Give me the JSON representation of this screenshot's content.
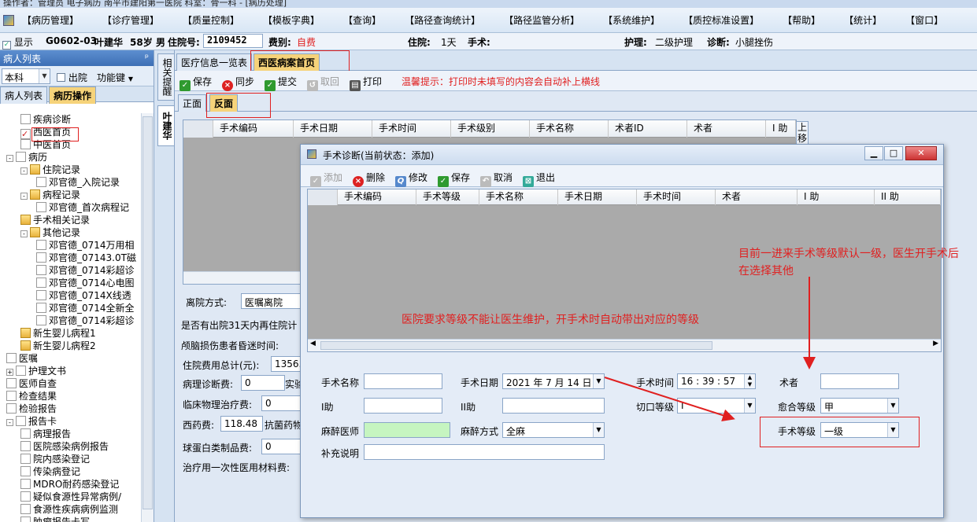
{
  "window_title": "操作者：管理员 电子病历 南平市建阳第一医院 科室：骨一科 - [病历处理]",
  "menu": [
    "【病历管理】",
    "【诊疗管理】",
    "【质量控制】",
    "【模板字典】",
    "【查询】",
    "【路径查询统计】",
    "【路径监管分析】",
    "【系统维护】",
    "【质控标准设置】",
    "【帮助】",
    "【统计】",
    "【窗口】"
  ],
  "patient": {
    "show_label": "显示",
    "bed_no": "G0602-03",
    "name": "叶建华",
    "age": "58岁",
    "sex": "男",
    "admission_no_label": "住院号:",
    "admission_no": "2109452",
    "fee_type_label": "费别:",
    "fee_type": "自费",
    "stay_label": "住院:",
    "stay": "1天",
    "surgery_label": "手术:",
    "nursing_label": "护理:",
    "nursing": "二级护理",
    "diagnosis_label": "诊断:",
    "diagnosis": "小腿挫伤"
  },
  "left_panel": {
    "title": "病人列表",
    "pin": "ᵖ",
    "dept": "本科",
    "discharged_label": "出院",
    "function_key_label": "功能键",
    "tabs": [
      "病人列表",
      "病历操作"
    ],
    "tree": [
      {
        "label": "疾病诊断",
        "level": 1,
        "icon": "doc"
      },
      {
        "label": "西医首页",
        "level": 1,
        "icon": "check"
      },
      {
        "label": "中医首页",
        "level": 1,
        "icon": "doc"
      },
      {
        "label": "病历",
        "level": 0,
        "icon": "doc",
        "expand": "-"
      },
      {
        "label": "住院记录",
        "level": 1,
        "icon": "folder",
        "expand": "-"
      },
      {
        "label": "邓官德_入院记录",
        "level": 2,
        "icon": "doc"
      },
      {
        "label": "病程记录",
        "level": 1,
        "icon": "folder",
        "expand": "-"
      },
      {
        "label": "邓官德_首次病程记",
        "level": 2,
        "icon": "doc"
      },
      {
        "label": "手术相关记录",
        "level": 1,
        "icon": "folder"
      },
      {
        "label": "其他记录",
        "level": 1,
        "icon": "folder",
        "expand": "-"
      },
      {
        "label": "邓官德_0714万用相",
        "level": 2,
        "icon": "doc"
      },
      {
        "label": "邓官德_07143.0T磁",
        "level": 2,
        "icon": "doc"
      },
      {
        "label": "邓官德_0714彩超诊",
        "level": 2,
        "icon": "doc"
      },
      {
        "label": "邓官德_0714心电图",
        "level": 2,
        "icon": "doc"
      },
      {
        "label": "邓官德_0714X线透",
        "level": 2,
        "icon": "doc"
      },
      {
        "label": "邓官德_0714全新全",
        "level": 2,
        "icon": "doc"
      },
      {
        "label": "邓官德_0714彩超诊",
        "level": 2,
        "icon": "doc"
      },
      {
        "label": "新生婴儿病程1",
        "level": 1,
        "icon": "folder"
      },
      {
        "label": "新生婴儿病程2",
        "level": 1,
        "icon": "folder"
      },
      {
        "label": "医嘱",
        "level": 0,
        "icon": "doc"
      },
      {
        "label": "护理文书",
        "level": 0,
        "icon": "doc",
        "expand": "+"
      },
      {
        "label": "医师自查",
        "level": 0,
        "icon": "doc"
      },
      {
        "label": "检查结果",
        "level": 0,
        "icon": "doc"
      },
      {
        "label": "检验报告",
        "level": 0,
        "icon": "doc"
      },
      {
        "label": "报告卡",
        "level": 0,
        "icon": "doc",
        "expand": "-"
      },
      {
        "label": "病理报告",
        "level": 1,
        "icon": "doc"
      },
      {
        "label": "医院感染病例报告",
        "level": 1,
        "icon": "doc"
      },
      {
        "label": "院内感染登记",
        "level": 1,
        "icon": "doc"
      },
      {
        "label": "传染病登记",
        "level": 1,
        "icon": "doc"
      },
      {
        "label": "MDRO耐药感染登记",
        "level": 1,
        "icon": "doc"
      },
      {
        "label": "疑似食源性异常病例/",
        "level": 1,
        "icon": "doc"
      },
      {
        "label": "食源性疾病病例监测",
        "level": 1,
        "icon": "doc"
      },
      {
        "label": "肿瘤报告卡写",
        "level": 1,
        "icon": "doc"
      }
    ]
  },
  "side_tabs": [
    "相关提醒",
    "叶建华"
  ],
  "main": {
    "top_tabs": [
      "医疗信息一览表",
      "西医病案首页"
    ],
    "toolbar": [
      "保存",
      "同步",
      "提交",
      "取回",
      "打印"
    ],
    "hint": "温馨提示：打印时未填写的内容会自动补上横线",
    "sub_tabs": [
      "正面",
      "反面"
    ],
    "grid_columns": [
      "手术编码",
      "手术日期",
      "手术时间",
      "手术级别",
      "手术名称",
      "术者ID",
      "术者",
      "I 助"
    ],
    "side_button": "上移",
    "form": {
      "discharge_mode_label": "离院方式:",
      "discharge_mode": "医嘱离院",
      "readmit_label": "是否有出院31天内再住院计",
      "coma_label": "颅脑损伤患者昏迷时间:",
      "total_cost_label": "住院费用总计(元):",
      "total_cost": "1356.",
      "pathology_fee_label": "病理诊断费:",
      "pathology_fee": "0",
      "lab_fee_label": "实验",
      "physio_label": "临床物理治疗费:",
      "physio_fee": "0",
      "western_med_label": "西药费:",
      "western_med": "118.48",
      "antibiotic_label": "抗菌药物",
      "globulin_label": "球蛋白类制品费:",
      "globulin_fee": "0",
      "disposable_label": "治疗用一次性医用材料费:"
    }
  },
  "dialog": {
    "title": "手术诊断(当前状态：添加)",
    "min": "▁",
    "max": "□",
    "close": "✕",
    "toolbar": [
      "添加",
      "删除",
      "修改",
      "保存",
      "取消",
      "退出"
    ],
    "grid_columns": [
      "手术编码",
      "手术等级",
      "手术名称",
      "手术日期",
      "手术时间",
      "术者",
      "I 助",
      "II 助"
    ],
    "form": {
      "op_name_label": "手术名称",
      "op_date_label": "手术日期",
      "op_date": "2021 年 7 月 14 日",
      "op_time_label": "手术时间",
      "op_time": "16 : 39 : 57",
      "surgeon_label": "术者",
      "assist1_label": "I助",
      "assist2_label": "II助",
      "incision_label": "切口等级",
      "incision": "I",
      "healing_label": "愈合等级",
      "healing": "甲",
      "anesthetist_label": "麻醉医师",
      "anesthesia_label": "麻醉方式",
      "anesthesia": "全麻",
      "op_grade_label": "手术等级",
      "op_grade": "一级",
      "supplement_label": "补充说明"
    }
  },
  "annotations": {
    "note1": "目前一进来手术等级默认一级，医生开手术后在选择其他",
    "note2": "医院要求等级不能让医生维护，开手术时自动带出对应的等级"
  },
  "colors": {
    "accent": "#e02020",
    "highlight": "#f6d37a",
    "anesthetist_bg": "#c6f5c0"
  }
}
